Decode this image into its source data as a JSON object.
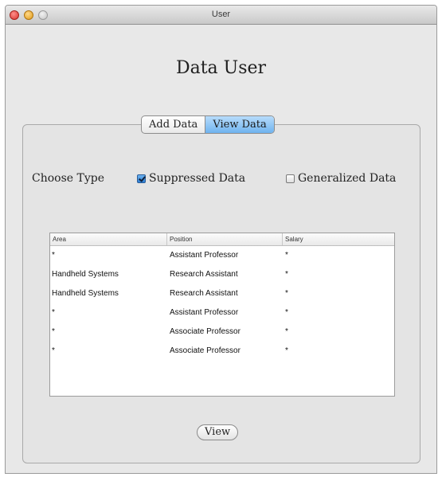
{
  "window": {
    "title": "User"
  },
  "page": {
    "title": "Data User"
  },
  "tabs": [
    {
      "label": "Add Data",
      "active": false
    },
    {
      "label": "View Data",
      "active": true
    }
  ],
  "filter": {
    "choose_type_label": "Choose Type",
    "suppressed_label": "Suppressed Data",
    "suppressed_checked": true,
    "generalized_label": "Generalized Data",
    "generalized_checked": false
  },
  "table": {
    "columns": [
      "Area",
      "Position",
      "Salary"
    ],
    "rows": [
      [
        "*",
        "Assistant Professor",
        "*"
      ],
      [
        "Handheld Systems",
        "Research Assistant",
        "*"
      ],
      [
        "Handheld Systems",
        "Research Assistant",
        "*"
      ],
      [
        "*",
        "Assistant Professor",
        "*"
      ],
      [
        "*",
        "Associate Professor",
        "*"
      ],
      [
        "*",
        "Associate Professor",
        "*"
      ]
    ]
  },
  "actions": {
    "view_label": "View"
  },
  "colors": {
    "active_tab": "#6fb3ef",
    "window_bg": "#e8e8e8",
    "close_button": "#d8322c",
    "minimize_button": "#e09a16"
  }
}
